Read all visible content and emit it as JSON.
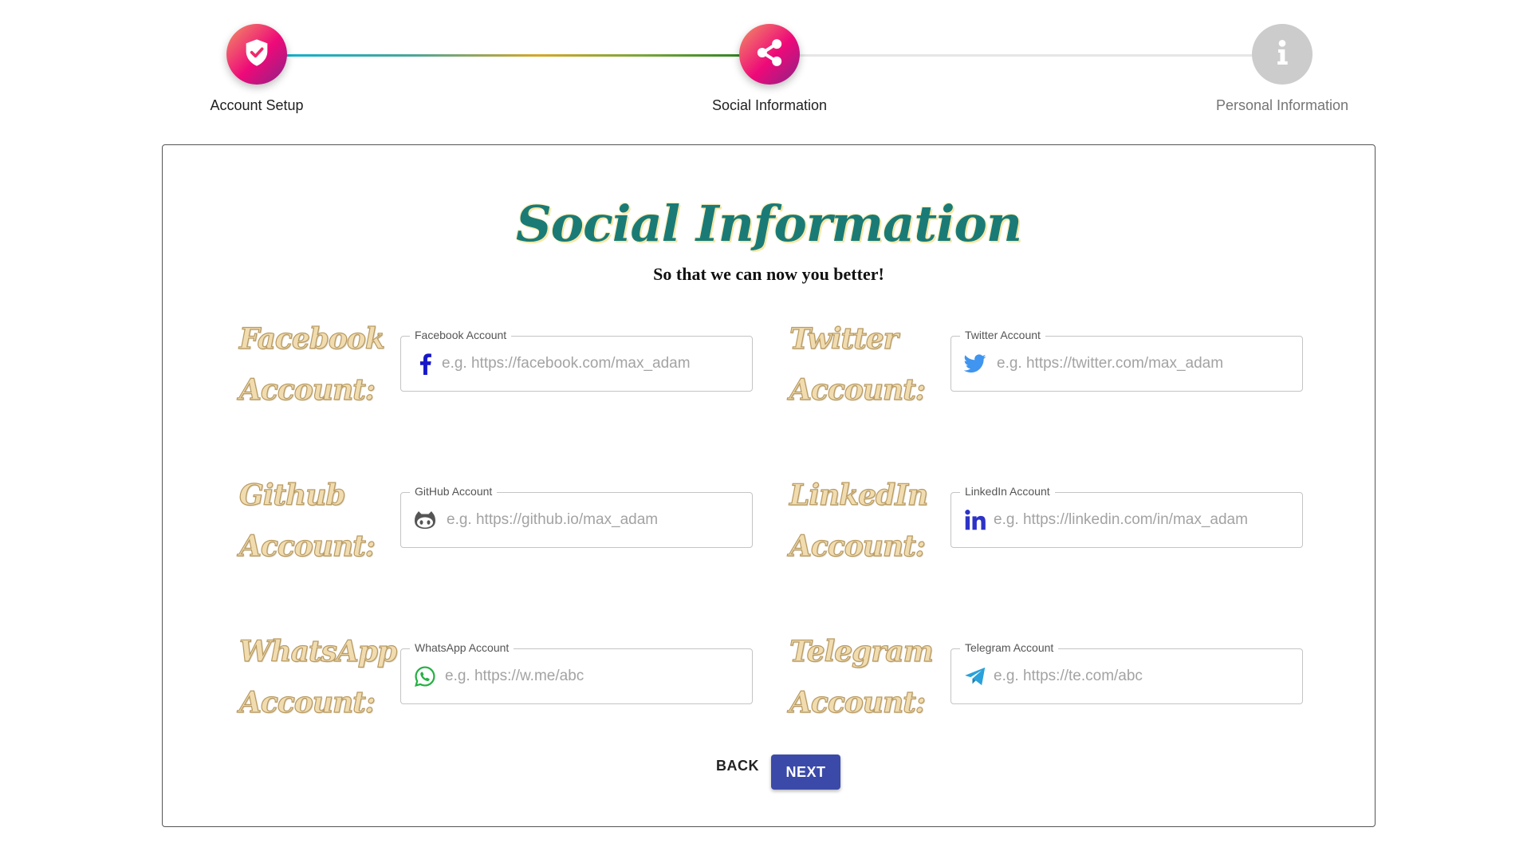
{
  "stepper": {
    "steps": [
      {
        "label": "Account Setup",
        "icon": "shield-check-icon",
        "state": "completed"
      },
      {
        "label": "Social Information",
        "icon": "share-icon",
        "state": "active"
      },
      {
        "label": "Personal Information",
        "icon": "info-icon",
        "state": "pending"
      }
    ]
  },
  "form": {
    "title": "Social Information",
    "subtitle": "So that we can now you better!",
    "fields": [
      {
        "side_label_1": "Facebook",
        "side_label_2": "Account:",
        "legend": "Facebook Account",
        "placeholder": "e.g. https://facebook.com/max_adam",
        "value": "",
        "icon": "facebook-icon"
      },
      {
        "side_label_1": "Twitter",
        "side_label_2": "Account:",
        "legend": "Twitter Account",
        "placeholder": "e.g. https://twitter.com/max_adam",
        "value": "",
        "icon": "twitter-icon"
      },
      {
        "side_label_1": "Github",
        "side_label_2": "Account:",
        "legend": "GitHub Account",
        "placeholder": "e.g. https://github.io/max_adam",
        "value": "",
        "icon": "github-icon"
      },
      {
        "side_label_1": "LinkedIn",
        "side_label_2": "Account:",
        "legend": "LinkedIn Account",
        "placeholder": "e.g. https://linkedin.com/in/max_adam",
        "value": "",
        "icon": "linkedin-icon"
      },
      {
        "side_label_1": "WhatsApp",
        "side_label_2": "Account:",
        "legend": "WhatsApp Account",
        "placeholder": "e.g. https://w.me/abc",
        "value": "",
        "icon": "whatsapp-icon"
      },
      {
        "side_label_1": "Telegram",
        "side_label_2": "Account:",
        "legend": "Telegram Account",
        "placeholder": "e.g. https://te.com/abc",
        "value": "",
        "icon": "telegram-icon"
      }
    ],
    "back_label": "BACK",
    "next_label": "NEXT"
  },
  "colors": {
    "primary_button": "#3b4aa8",
    "title": "#1a7b76",
    "active_step_gradient": [
      "#f29263",
      "#ee0979",
      "#8a2387"
    ],
    "pending_step": "#cccccc",
    "facebook": "#1877f2",
    "twitter": "#1da1f2",
    "github": "#555555",
    "linkedin": "#2d33c7",
    "whatsapp": "#25d366",
    "telegram": "#2aa1da"
  }
}
